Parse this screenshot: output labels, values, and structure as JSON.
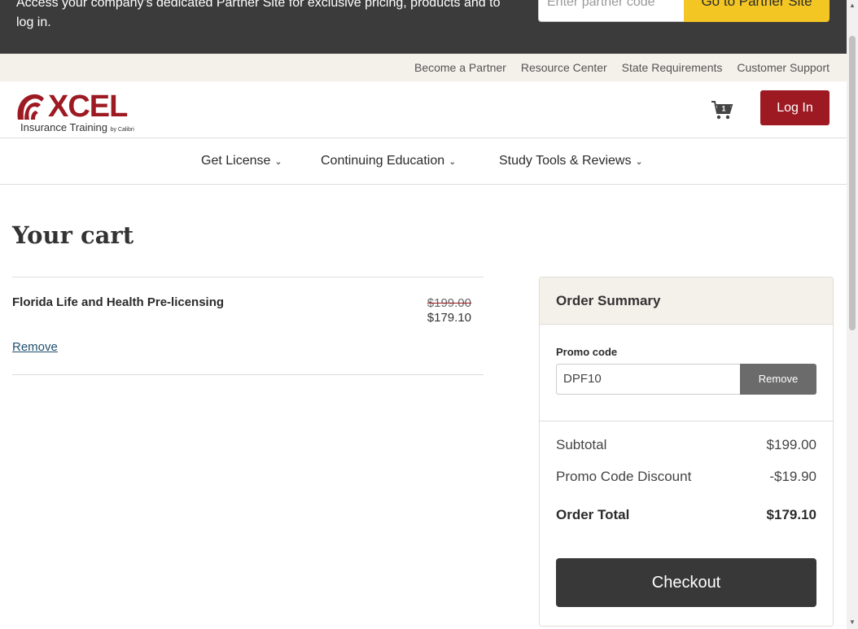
{
  "partner_banner": {
    "text": "Access your company's dedicated Partner Site for exclusive pricing, products and to log in.",
    "input_placeholder": "Enter partner code",
    "button_label": "Go to Partner Site"
  },
  "utility_links": [
    "Become a Partner",
    "Resource Center",
    "State Requirements",
    "Customer Support"
  ],
  "header": {
    "logo_word": "XCEL",
    "logo_sub": "Insurance Training",
    "logo_by": "by Calibri",
    "cart_count": "1",
    "login_label": "Log In"
  },
  "nav": {
    "items": [
      "Get License",
      "Continuing Education",
      "Study Tools & Reviews"
    ]
  },
  "cart": {
    "title": "Your cart",
    "item": {
      "name": "Florida Life and Health Pre-licensing",
      "original_price": "$199.00",
      "sale_price": "$179.10",
      "remove_label": "Remove"
    }
  },
  "summary": {
    "title": "Order Summary",
    "promo_label": "Promo code",
    "promo_value": "DPF10",
    "promo_button": "Remove",
    "subtotal_label": "Subtotal",
    "subtotal_value": "$199.00",
    "discount_label": "Promo Code Discount",
    "discount_value": "-$19.90",
    "total_label": "Order Total",
    "total_value": "$179.10",
    "checkout_label": "Checkout"
  },
  "colors": {
    "brand_red": "#9d1a22",
    "partner_yellow": "#f3c623",
    "dark": "#383838",
    "beige": "#f4f0ea"
  }
}
